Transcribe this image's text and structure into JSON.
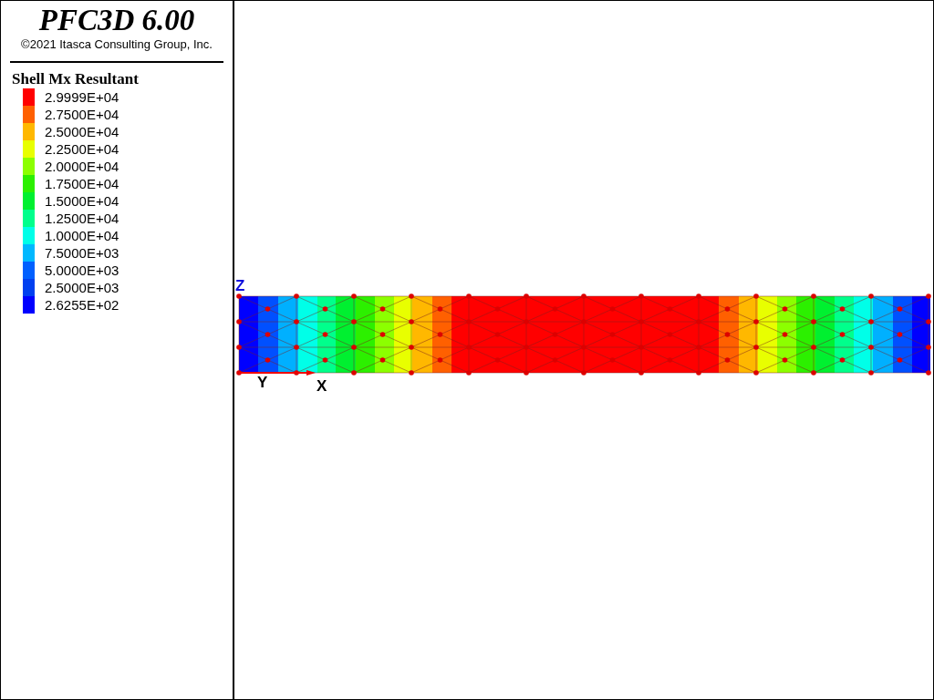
{
  "header": {
    "title": "PFC3D 6.00",
    "copyright": "©2021 Itasca Consulting Group, Inc."
  },
  "legend": {
    "title": "Shell Mx Resultant",
    "items": [
      {
        "label": "2.9999E+04",
        "color": "#ff0000"
      },
      {
        "label": "2.7500E+04",
        "color": "#ff6000"
      },
      {
        "label": "2.5000E+04",
        "color": "#ffb800"
      },
      {
        "label": "2.2500E+04",
        "color": "#e8ff00"
      },
      {
        "label": "2.0000E+04",
        "color": "#8cff00"
      },
      {
        "label": "1.7500E+04",
        "color": "#2cf000"
      },
      {
        "label": "1.5000E+04",
        "color": "#00f030"
      },
      {
        "label": "1.2500E+04",
        "color": "#00ff8c"
      },
      {
        "label": "1.0000E+04",
        "color": "#00ffe8"
      },
      {
        "label": "7.5000E+03",
        "color": "#00b8ff"
      },
      {
        "label": "5.0000E+03",
        "color": "#0060ff"
      },
      {
        "label": "2.5000E+03",
        "color": "#0040f0"
      },
      {
        "label": "2.6255E+02",
        "color": "#0000ff"
      }
    ]
  },
  "axes": {
    "z": "Z",
    "y": "Y",
    "x": "X"
  }
}
